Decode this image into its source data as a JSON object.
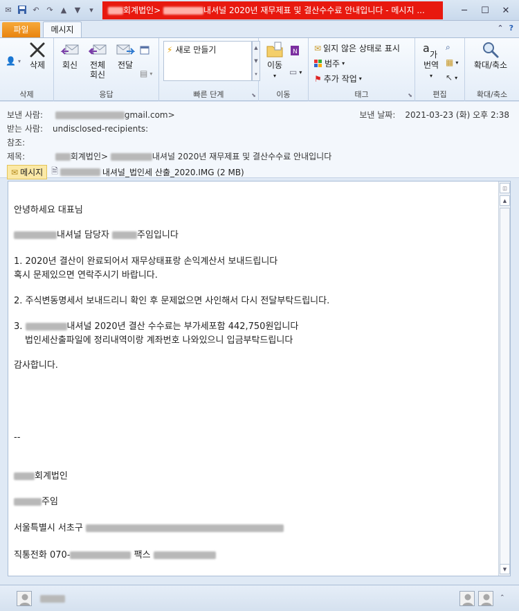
{
  "window": {
    "title_firm": "회계법인>",
    "title_subject": "내셔널 2020년 재무제표 및 결산수수료 안내입니다 - 메시지 ..."
  },
  "tabs": {
    "file": "파일",
    "message": "메시지"
  },
  "ribbon": {
    "delete_group": "삭제",
    "delete": "삭제",
    "reply": "회신",
    "reply_all_1": "전체",
    "reply_all_2": "회신",
    "forward": "전달",
    "respond_group": "응답",
    "quick_new": "새로 만들기",
    "quick_group": "빠른 단계",
    "move": "이동",
    "move_group": "이동",
    "mark_unread": "읽지 않은 상태로 표시",
    "categorize": "범주",
    "followup": "추가 작업",
    "tags_group": "태그",
    "translate": "번역",
    "editing_group": "편집",
    "zoom": "확대/축소",
    "zoom_group": "확대/축소"
  },
  "header": {
    "from_label": "보낸 사람:",
    "from_suffix": "gmail.com>",
    "to_label": "받는 사람:",
    "to_value": "undisclosed-recipients:",
    "cc_label": "참조:",
    "subject_label": "제목:",
    "subject_firm": "회계법인>",
    "subject_rest": "내셔널 2020년 재무제표 및 결산수수료 안내입니다",
    "sent_label": "보낸 날짜:",
    "sent_value": "2021-03-23 (화) 오후 2:38",
    "message_chip": "메시지",
    "attachment": "내셔널_법인세 산출_2020.IMG (2 MB)"
  },
  "body": {
    "greeting": "안녕하세요 대표님",
    "intro_suffix": "내셔널 담당자",
    "intro_end": "주임입니다",
    "item1_a": "1. 2020년 결산이 완료되어서 재무상태표랑 손익계산서 보내드립니다",
    "item1_b": "혹시 문제있으면 연락주시기 바랍니다.",
    "item2": "2. 주식변동명세서 보내드리니 확인 후 문제없으면 사인해서 다시 전달부탁드립니다.",
    "item3_prefix": "3.",
    "item3_a": "내셔널 2020년 결산 수수료는 부가세포함 442,750원입니다",
    "item3_b": "법인세산출파일에 정리내역이랑 계좌번호 나와있으니 입금부탁드립니다",
    "thanks": "감사합니다.",
    "sig_sep": "--",
    "sig_firm": "회계법인",
    "sig_title": "주임",
    "sig_addr": "서울특별시 서초구",
    "sig_phone_label": "직통전화 070-",
    "sig_fax_label": "팩스"
  }
}
